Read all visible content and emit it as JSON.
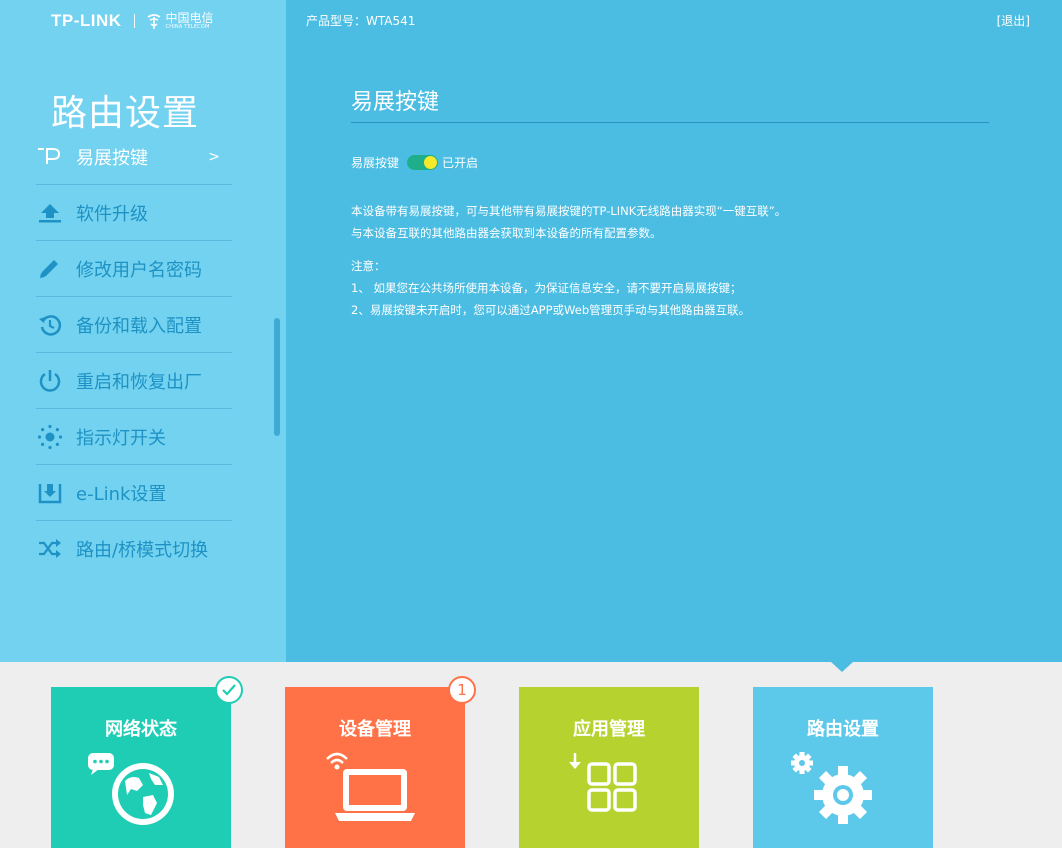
{
  "brand": {
    "logo_text": "TP-LINK",
    "telecom_cn": "中国电信",
    "telecom_en": "CHINA TELECOM"
  },
  "header": {
    "model": "产品型号：WTA541",
    "logout": "[退出]"
  },
  "sidebar": {
    "title": "路由设置",
    "items": [
      {
        "label": "易展按键",
        "icon": "easy-expand-icon",
        "active": true,
        "arrow": ">"
      },
      {
        "label": "软件升级",
        "icon": "upload-icon"
      },
      {
        "label": "修改用户名密码",
        "icon": "pencil-icon"
      },
      {
        "label": "备份和载入配置",
        "icon": "history-icon"
      },
      {
        "label": "重启和恢复出厂",
        "icon": "power-icon"
      },
      {
        "label": "指示灯开关",
        "icon": "led-icon"
      },
      {
        "label": "e-Link设置",
        "icon": "download-box-icon"
      },
      {
        "label": "路由/桥模式切换",
        "icon": "shuffle-icon"
      }
    ]
  },
  "main": {
    "title": "易展按键",
    "toggle_label": "易展按键",
    "toggle_state": "已开启",
    "desc_lines": [
      "本设备带有易展按键，可与其他带有易展按键的TP-LINK无线路由器实现“一键互联”。",
      "与本设备互联的其他路由器会获取到本设备的所有配置参数。"
    ],
    "notes_title": "注意：",
    "notes_lines": [
      "1、 如果您在公共场所使用本设备，为保证信息安全，请不要开启易展按键；",
      "2、易展按键未开启时，您可以通过APP或Web管理页手动与其他路由器互联。"
    ]
  },
  "tiles": [
    {
      "label": "网络状态",
      "color": "#1fcdb5",
      "icon": "globe-icon",
      "badge": "check"
    },
    {
      "label": "设备管理",
      "color": "#ff7146",
      "icon": "laptop-wifi-icon",
      "badge": "1"
    },
    {
      "label": "应用管理",
      "color": "#b5d22f",
      "icon": "apps-grid-icon"
    },
    {
      "label": "路由设置",
      "color": "#5cc8ea",
      "icon": "gears-icon",
      "active": true
    }
  ],
  "colors": {
    "main_bg": "#4bbde3",
    "sidebar_bg": "#72d2f0",
    "sidebar_text": "#1e92c4",
    "toggle_on": "#1fae8a",
    "toggle_knob": "#f4ea2b"
  }
}
